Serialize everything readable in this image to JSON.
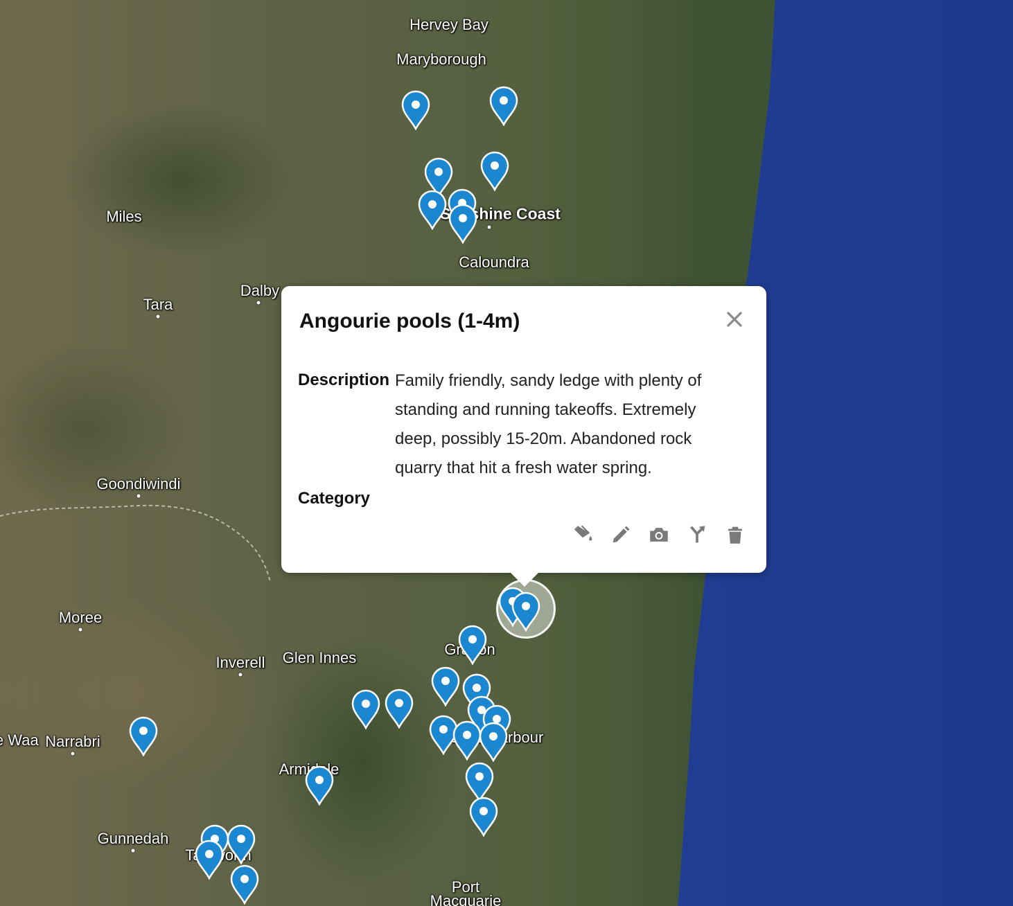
{
  "map": {
    "place_labels": [
      {
        "name": "Hervey Bay",
        "bold": false
      },
      {
        "name": "Maryborough",
        "bold": false
      },
      {
        "name": "Miles",
        "bold": false
      },
      {
        "name": "Sunshine Coast",
        "bold": true
      },
      {
        "name": "Caloundra",
        "bold": false
      },
      {
        "name": "Dalby",
        "bold": false
      },
      {
        "name": "Tara",
        "bold": false
      },
      {
        "name": "Goondiwindi",
        "bold": false
      },
      {
        "name": "Moree",
        "bold": false
      },
      {
        "name": "Inverell",
        "bold": false
      },
      {
        "name": "Glen Innes",
        "bold": false
      },
      {
        "name": "Grafton",
        "bold": false
      },
      {
        "name": "Narrabri",
        "bold": false
      },
      {
        "name": "Wee Waa",
        "bold": false
      },
      {
        "name": "Armidale",
        "bold": false
      },
      {
        "name": "Coffs Harbour",
        "bold": false
      },
      {
        "name": "Gunnedah",
        "bold": false
      },
      {
        "name": "Tamworth",
        "bold": false
      },
      {
        "name": "Port",
        "bold": false
      },
      {
        "name": "Macquarie",
        "bold": false
      }
    ],
    "pin_color": "#1a87d0",
    "water_color": "#2a46a3"
  },
  "popup": {
    "title": "Angourie pools (1-4m)",
    "fields": [
      {
        "label": "Description",
        "value": "Family friendly, sandy ledge with plenty of standing and running takeoffs. Extremely deep, possibly 15-20m. Abandoned rock quarry that hit a fresh water spring."
      },
      {
        "label": "Category",
        "value": ""
      }
    ],
    "toolbar_icons": [
      "paint-bucket-icon",
      "pencil-icon",
      "camera-icon",
      "directions-icon",
      "trash-icon"
    ]
  }
}
